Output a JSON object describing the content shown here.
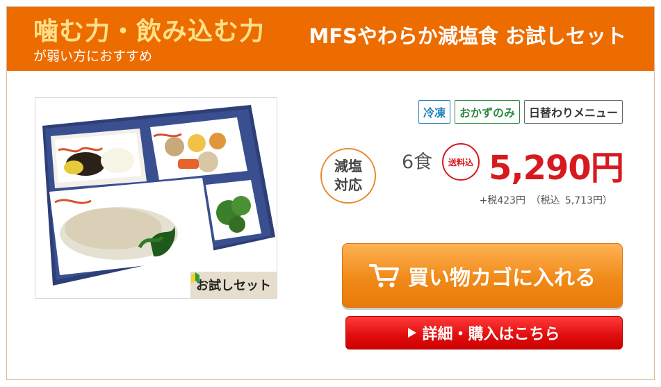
{
  "header": {
    "catch_main": "噛む力・飲み込む力",
    "catch_sub": "が弱い方におすすめ",
    "product_title": "MFSやわらか減塩食 お試しセット"
  },
  "photo": {
    "tag_label": "お試しセット",
    "tag_icon": "beginner-leaf-icon"
  },
  "tags": [
    "冷凍",
    "おかずのみ",
    "日替わりメニュー"
  ],
  "badge": {
    "line1": "減塩",
    "line2": "対応"
  },
  "pricing": {
    "meals": "6食",
    "shipping_label": "送料込",
    "price": "5,290円",
    "tax_note": "+税423円 （税込 5,713円）"
  },
  "buttons": {
    "cart_label": "買い物カゴに入れる",
    "cart_icon": "cart-icon",
    "detail_label": "詳細・購入はこちら",
    "detail_icon": "triangle-right-icon"
  },
  "colors": {
    "header_bg": "#ed6c00",
    "catch_color": "#ffe08a",
    "price_red": "#d71920",
    "cart_orange": "#f08a18",
    "detail_red": "#e00d0d"
  }
}
